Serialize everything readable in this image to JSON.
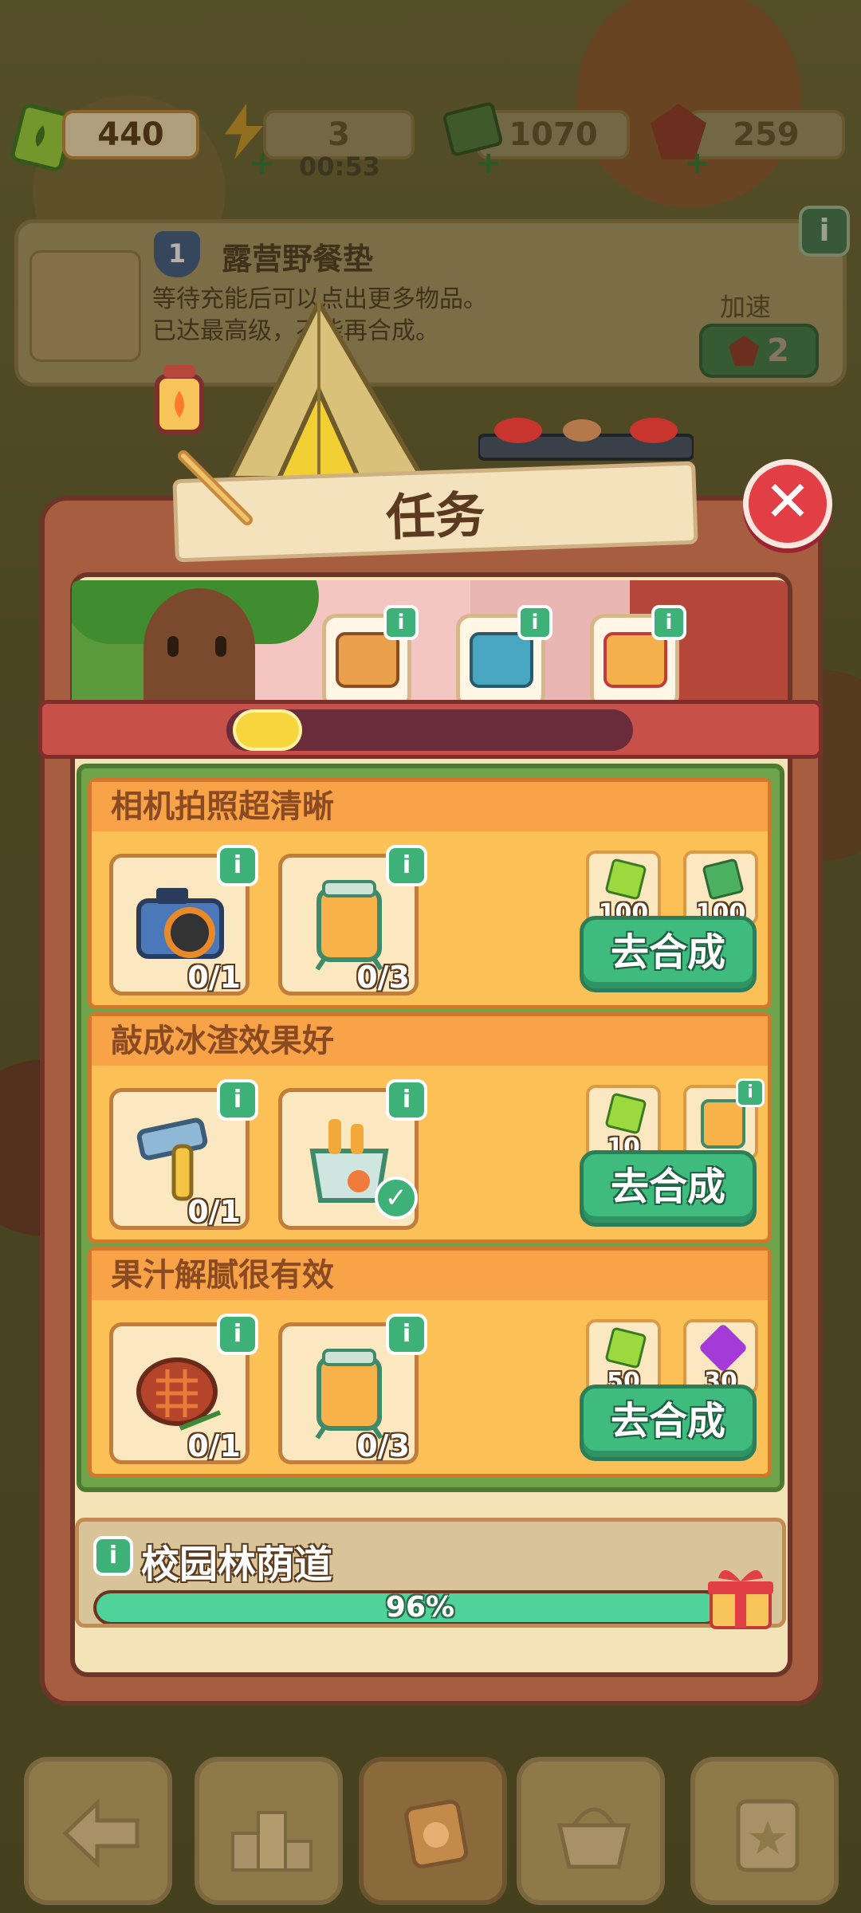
{
  "currency": {
    "ticket": "440",
    "energy": "3",
    "energy_timer": "00:53",
    "cash": "1070",
    "gems": "259"
  },
  "info_card": {
    "level": "1",
    "title": "露营野餐垫",
    "desc_line1": "等待充能后可以点出更多物品。",
    "desc_line2": "已达最高级，不能再合成。",
    "speed_label": "加速",
    "speed_cost": "2"
  },
  "panel": {
    "title": "任务",
    "close": "✕",
    "progress_fraction": 0.17
  },
  "chests": [
    {
      "i": "i",
      "color": "#e8a04a"
    },
    {
      "i": "i",
      "color": "#48a6c0"
    },
    {
      "i": "i",
      "color": "#f4b04a"
    }
  ],
  "tasks": [
    {
      "title": "相机拍照超清晰",
      "slots": [
        {
          "count": "0/1",
          "icon": "camera-icon",
          "i": "i"
        },
        {
          "count": "0/3",
          "icon": "juice-dispenser-icon",
          "i": "i"
        }
      ],
      "rewards": [
        {
          "value": "100",
          "icon": "ticket-icon"
        },
        {
          "value": "100",
          "icon": "cash-icon"
        }
      ],
      "button": "去合成"
    },
    {
      "title": "敲成冰渣效果好",
      "slots": [
        {
          "count": "0/1",
          "icon": "hammer-icon",
          "i": "i"
        },
        {
          "count": "",
          "icon": "ice-bucket-icon",
          "i": "i",
          "done": true
        }
      ],
      "rewards": [
        {
          "value": "10",
          "icon": "ticket-icon"
        },
        {
          "value": "",
          "icon": "juice-dispenser-icon",
          "i": "i"
        }
      ],
      "button": "去合成"
    },
    {
      "title": "果汁解腻很有效",
      "slots": [
        {
          "count": "0/1",
          "icon": "steak-icon",
          "i": "i"
        },
        {
          "count": "0/3",
          "icon": "juice-dispenser-icon",
          "i": "i"
        }
      ],
      "rewards": [
        {
          "value": "50",
          "icon": "ticket-icon"
        },
        {
          "value": "30",
          "icon": "purple-gem-icon"
        }
      ],
      "button": "去合成"
    }
  ],
  "map_progress": {
    "i": "i",
    "title": "校园林荫道",
    "percent_text": "96%",
    "percent": 0.96
  },
  "colors": {
    "accent_green": "#3fbb7e",
    "panel_brown": "#a65d40",
    "task_orange": "#fbc157",
    "close_red": "#e23e45"
  }
}
